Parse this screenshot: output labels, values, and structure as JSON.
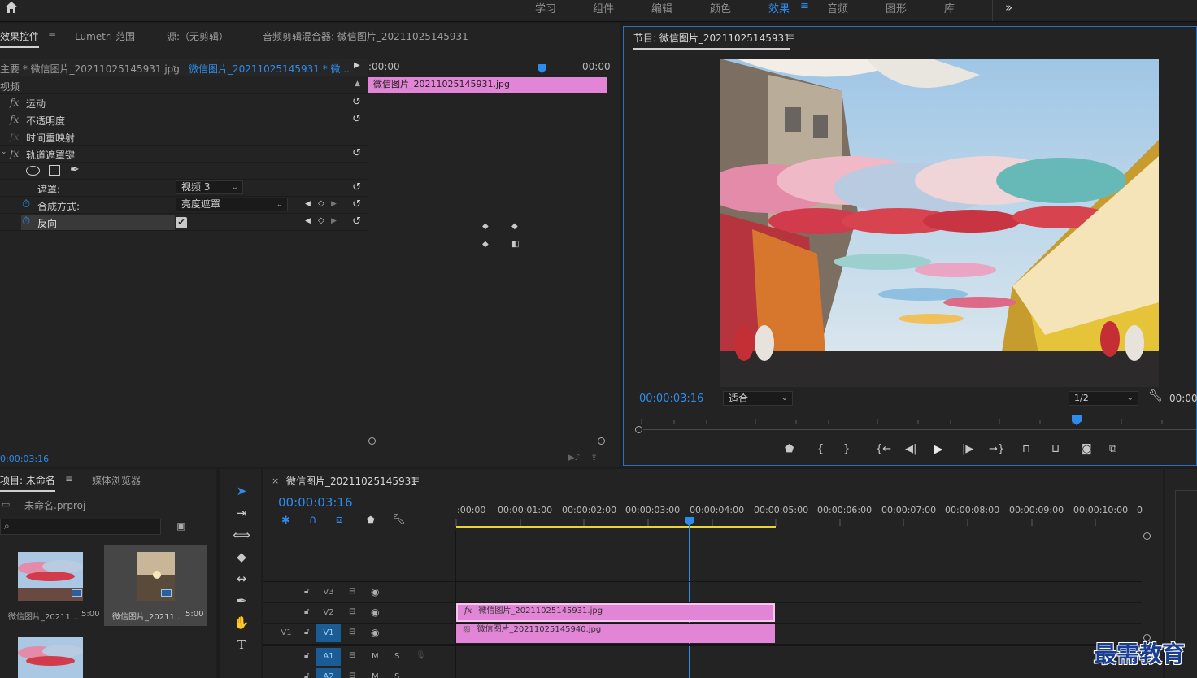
{
  "topbar": {
    "home_icon": "home-icon",
    "tabs": [
      {
        "label": "学习"
      },
      {
        "label": "组件"
      },
      {
        "label": "编辑"
      },
      {
        "label": "颜色"
      },
      {
        "label": "效果",
        "active": true
      },
      {
        "label": "音频"
      },
      {
        "label": "图形"
      },
      {
        "label": "库"
      }
    ],
    "more_icon": "double-chevron-right-icon"
  },
  "effects_panel": {
    "tabs": [
      "效果控件",
      "Lumetri 范围",
      "源:（无剪辑）",
      "音频剪辑混合器: 微信图片_20211025145931"
    ],
    "master_label": "主要 * 微信图片_20211025145931.jpg",
    "clip_label": "微信图片_20211025145931 * 微...",
    "time_start": ":00:00",
    "time_end": "00:00",
    "clip_bar_label": "微信图片_20211025145931.jpg",
    "section_video": "视频",
    "rows": {
      "motion": "运动",
      "opacity": "不透明度",
      "time_remap": "时间重映射",
      "track_matte": "轨道遮罩键",
      "matte_label": "遮罩:",
      "matte_value": "视频 3",
      "composite_label": "合成方式:",
      "composite_value": "亮度遮罩",
      "reverse_label": "反向"
    },
    "current_time": "0:00:03:16"
  },
  "program_monitor": {
    "title": "节目: 微信图片_20211025145931",
    "timecode": "00:00:03:16",
    "fit_label": "适合",
    "resolution": "1/2",
    "end_time": "00:00"
  },
  "project_panel": {
    "tabs": [
      "项目: 未命名",
      "媒体浏览器"
    ],
    "project_file": "未命名.prproj",
    "items": [
      {
        "name": "微信图片_20211...",
        "duration": "5:00"
      },
      {
        "name": "微信图片_20211...",
        "duration": "5:00"
      }
    ]
  },
  "timeline": {
    "title": "微信图片_20211025145931",
    "timecode": "00:00:03:16",
    "ruler": [
      ":00:00",
      "00:00:01:00",
      "00:00:02:00",
      "00:00:03:00",
      "00:00:04:00",
      "00:00:05:00",
      "00:00:06:00",
      "00:00:07:00",
      "00:00:08:00",
      "00:00:09:00",
      "00:00:10:00",
      "0"
    ],
    "tracks": {
      "v3": "V3",
      "v2": "V2",
      "v1": "V1",
      "v1_src": "V1",
      "a1": "A1",
      "a2": "A2",
      "m": "M",
      "s": "S"
    },
    "clips": {
      "v2_clip": "微信图片_20211025145931.jpg",
      "v1_clip": "微信图片_20211025145940.jpg"
    }
  },
  "watermark": "最需教育",
  "colors": {
    "accent": "#2d8ceb",
    "clip": "#e385d6",
    "panel": "#232323",
    "playhead": "#2d8ceb"
  }
}
